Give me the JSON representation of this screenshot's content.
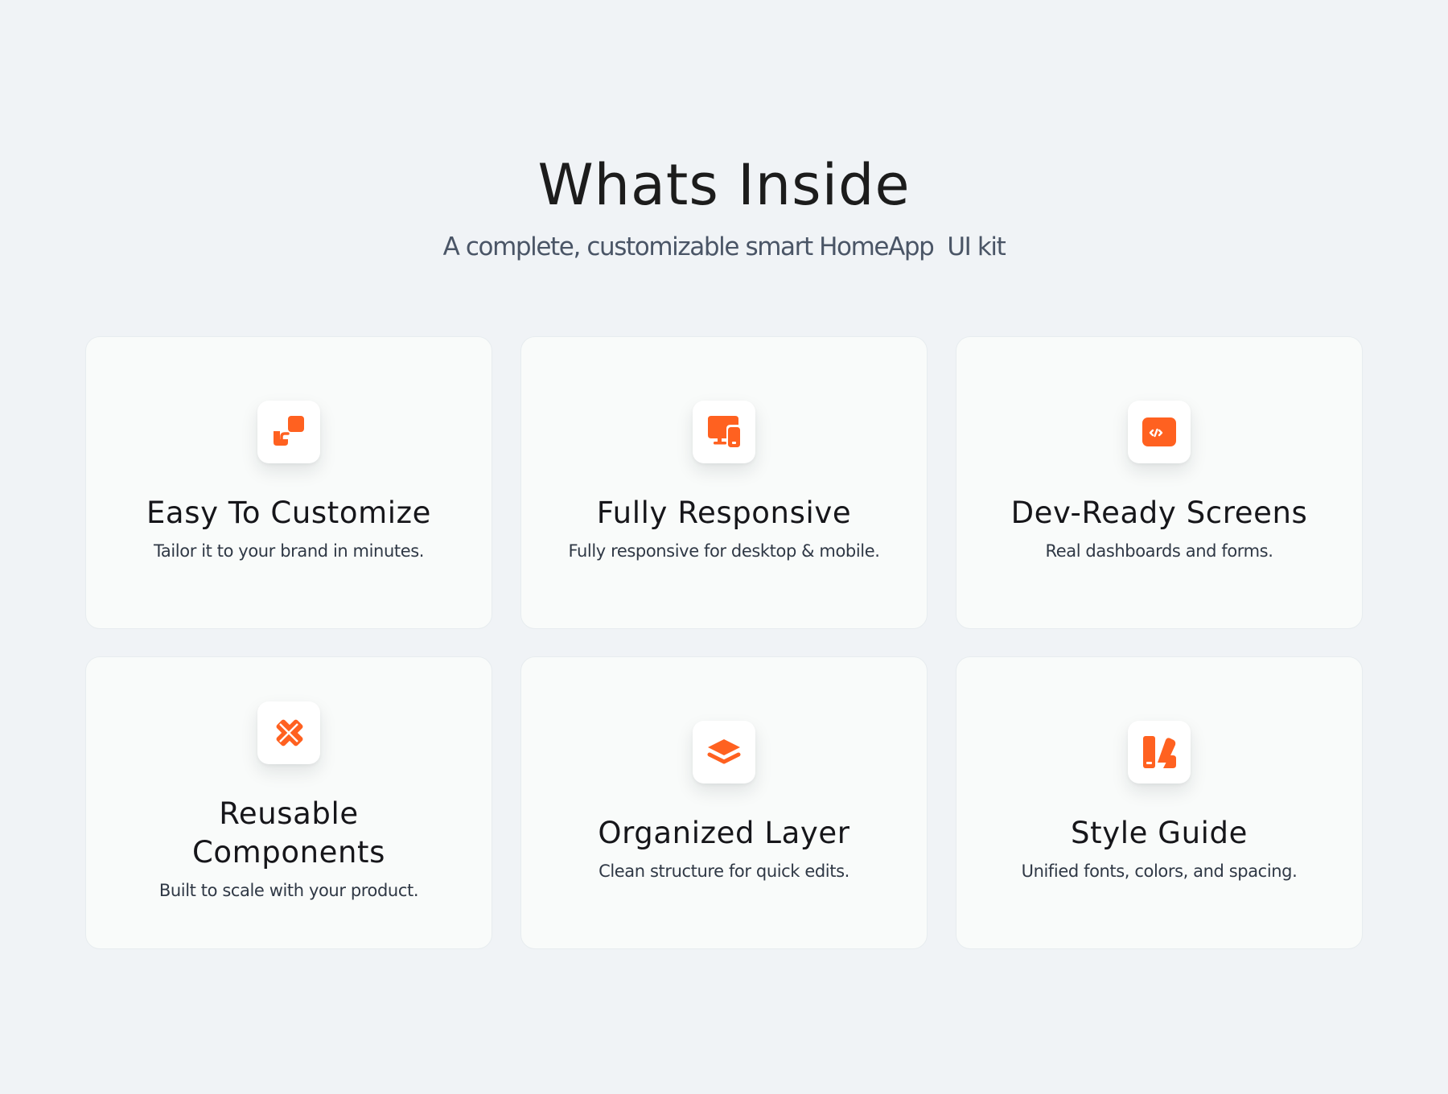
{
  "header": {
    "title": "Whats Inside",
    "subtitle": "A complete, customizable smart HomeApp  UI kit"
  },
  "colors": {
    "accent": "#ff6120",
    "background": "#f0f3f6",
    "card": "#f9fbfa"
  },
  "features": [
    {
      "icon": "customize-icon",
      "title": "Easy To Customize",
      "description": "Tailor it to your brand in minutes."
    },
    {
      "icon": "devices-icon",
      "title": "Fully Responsive",
      "description": "Fully responsive for desktop & mobile."
    },
    {
      "icon": "code-screen-icon",
      "title": "Dev-Ready Screens",
      "description": "Real dashboards and forms."
    },
    {
      "icon": "pencil-ruler-icon",
      "title": "Reusable Components",
      "description": "Built to scale with your product."
    },
    {
      "icon": "layers-icon",
      "title": "Organized Layer",
      "description": "Clean structure for quick edits."
    },
    {
      "icon": "swatch-icon",
      "title": "Style Guide",
      "description": "Unified fonts, colors, and spacing."
    }
  ]
}
